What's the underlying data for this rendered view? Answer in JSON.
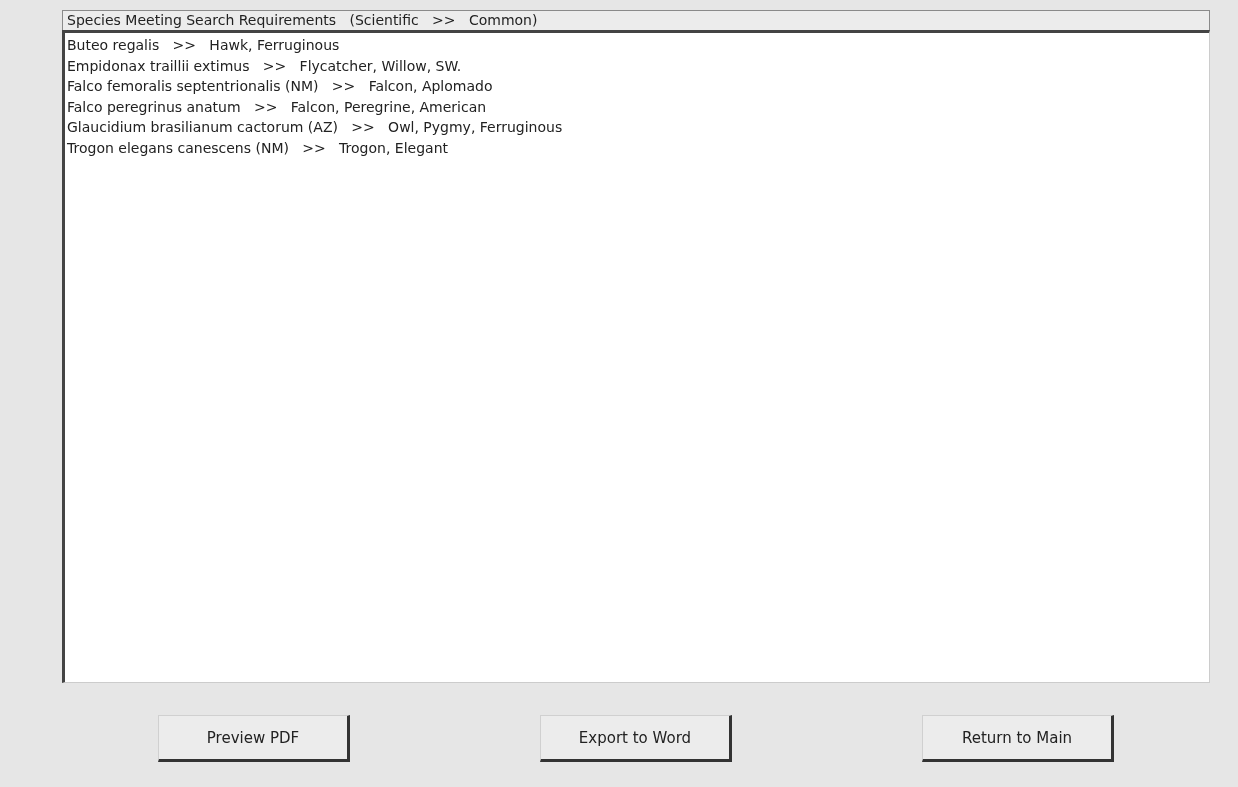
{
  "list_header": "Species Meeting Search Requirements   (Scientific   >>   Common)",
  "species": [
    {
      "text": "Buteo regalis   >>   Hawk, Ferruginous"
    },
    {
      "text": "Empidonax traillii extimus   >>   Flycatcher, Willow, SW."
    },
    {
      "text": "Falco femoralis septentrionalis (NM)   >>   Falcon, Aplomado"
    },
    {
      "text": "Falco peregrinus anatum   >>   Falcon, Peregrine, American"
    },
    {
      "text": "Glaucidium brasilianum cactorum (AZ)   >>   Owl, Pygmy, Ferruginous"
    },
    {
      "text": "Trogon elegans canescens (NM)   >>   Trogon, Elegant"
    }
  ],
  "buttons": [
    {
      "label": "Preview PDF"
    },
    {
      "label": "Export to Word"
    },
    {
      "label": "Return to Main"
    }
  ]
}
